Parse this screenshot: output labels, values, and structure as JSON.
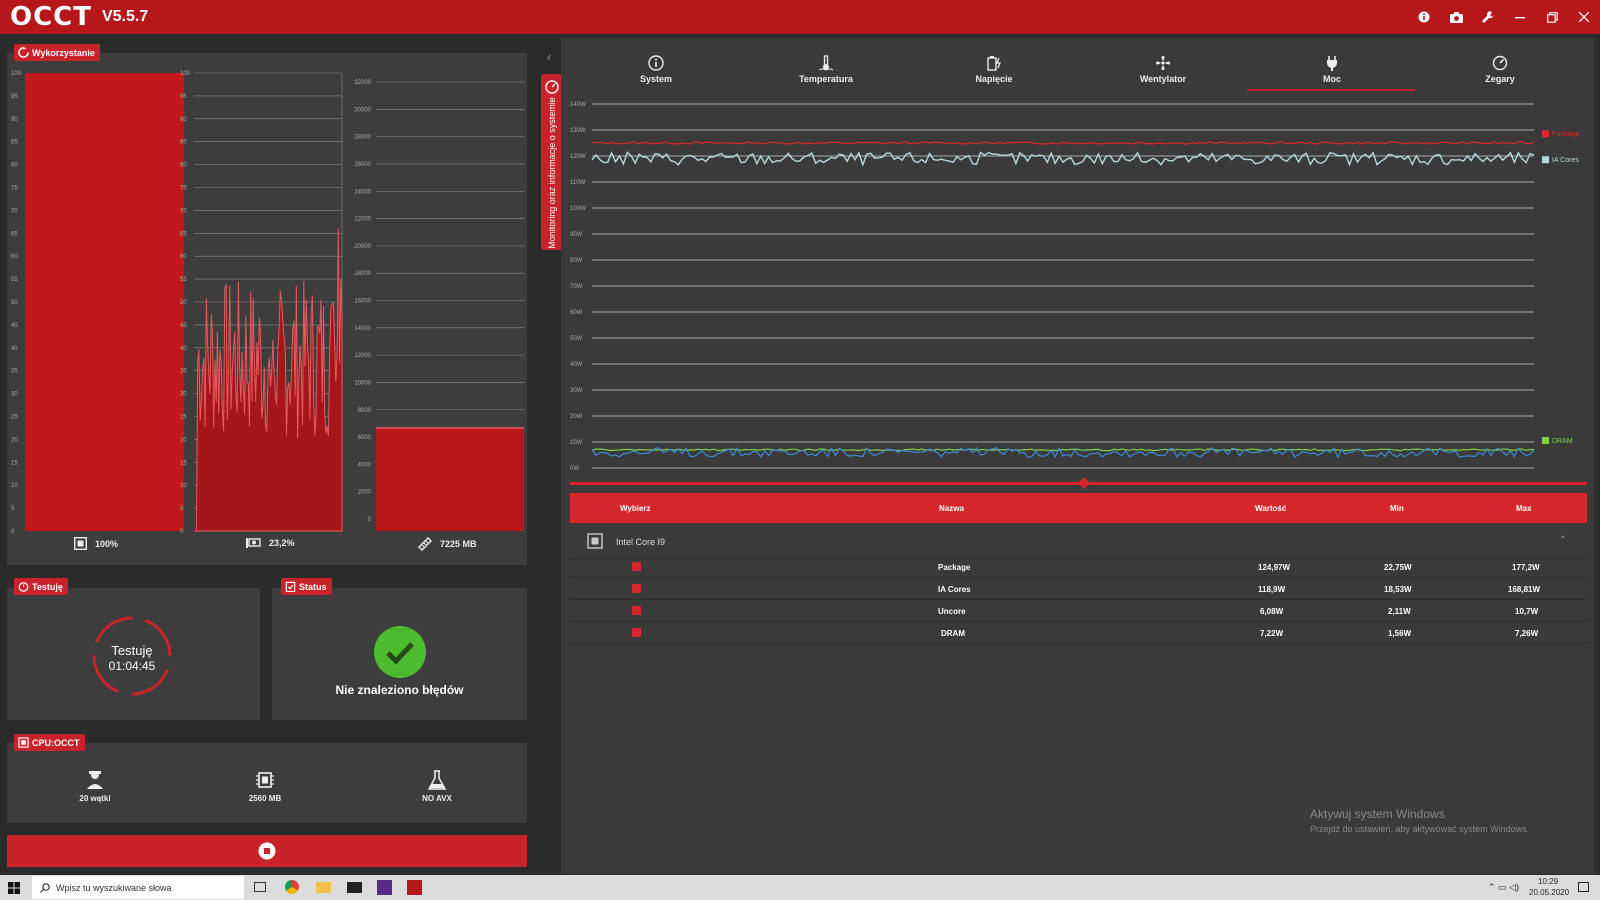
{
  "app": {
    "logo": "OCCT",
    "version": "V5.5.7"
  },
  "title_icons": [
    "info-icon",
    "camera-icon",
    "wrench-icon",
    "minimize-icon",
    "restore-icon",
    "close-icon"
  ],
  "usage": {
    "tag": "Wykorzystanie",
    "cpu_axis": [
      "100",
      "95",
      "90",
      "85",
      "80",
      "75",
      "70",
      "65",
      "60",
      "55",
      "50",
      "45",
      "40",
      "35",
      "30",
      "25",
      "20",
      "15",
      "10",
      "5",
      "0"
    ],
    "mem_axis": [
      "32000",
      "30000",
      "28000",
      "26000",
      "24000",
      "22000",
      "20000",
      "18000",
      "16000",
      "14000",
      "12000",
      "10000",
      "8000",
      "6000",
      "4000",
      "2000",
      "0"
    ],
    "cpu_value": "100%",
    "load_value": "23,2%",
    "mem_value": "7225 MB"
  },
  "testing": {
    "tag": "Testuję",
    "label": "Testuję",
    "time": "01:04:45"
  },
  "status": {
    "tag": "Status",
    "message": "Nie znaleziono błędów"
  },
  "cpu_test": {
    "tag": "CPU:OCCT",
    "threads": "20 wątki",
    "memory": "2560 MB",
    "instr": "NO AVX"
  },
  "side_tab": "Monitoring oraz informacje o systemie",
  "tabs": [
    {
      "label": "System",
      "icon": "info-icon"
    },
    {
      "label": "Temperatura",
      "icon": "thermometer-icon"
    },
    {
      "label": "Napięcie",
      "icon": "voltage-icon"
    },
    {
      "label": "Wentylator",
      "icon": "fan-icon"
    },
    {
      "label": "Moc",
      "icon": "plug-icon",
      "active": true
    },
    {
      "label": "Zegary",
      "icon": "gauge-icon"
    }
  ],
  "chart_data": {
    "type": "line",
    "yticks": [
      "140W",
      "130W",
      "120W",
      "110W",
      "100W",
      "90W",
      "80W",
      "70W",
      "60W",
      "50W",
      "40W",
      "30W",
      "20W",
      "10W",
      "0W"
    ],
    "ylim": [
      0,
      140
    ],
    "series": [
      {
        "name": "Package",
        "color": "#e0262c",
        "approx": 125
      },
      {
        "name": "IA Cores",
        "color": "#b8d8e0",
        "approx": 119
      },
      {
        "name": "DRAM",
        "color": "#7fd24a",
        "approx": 7
      },
      {
        "name": "",
        "color": "#3d8ad8",
        "approx": 6
      }
    ]
  },
  "table": {
    "headers": {
      "select": "Wybierz",
      "name": "Nazwa",
      "value": "Wartość",
      "min": "Min",
      "max": "Max"
    },
    "group": "Intel Core I9",
    "rows": [
      {
        "name": "Package",
        "value": "124,97W",
        "min": "22,75W",
        "max": "177,2W"
      },
      {
        "name": "IA Cores",
        "value": "118,9W",
        "min": "18,53W",
        "max": "168,81W"
      },
      {
        "name": "Uncore",
        "value": "6,08W",
        "min": "2,11W",
        "max": "10,7W"
      },
      {
        "name": "DRAM",
        "value": "7,22W",
        "min": "1,56W",
        "max": "7,26W"
      }
    ]
  },
  "watermark": {
    "title": "Aktywuj system Windows",
    "sub": "Przejdź do ustawień, aby aktywować system Windows."
  },
  "taskbar": {
    "search_placeholder": "Wpisz tu wyszukiwane słowa",
    "time": "10:29",
    "date": "20.05.2020"
  }
}
